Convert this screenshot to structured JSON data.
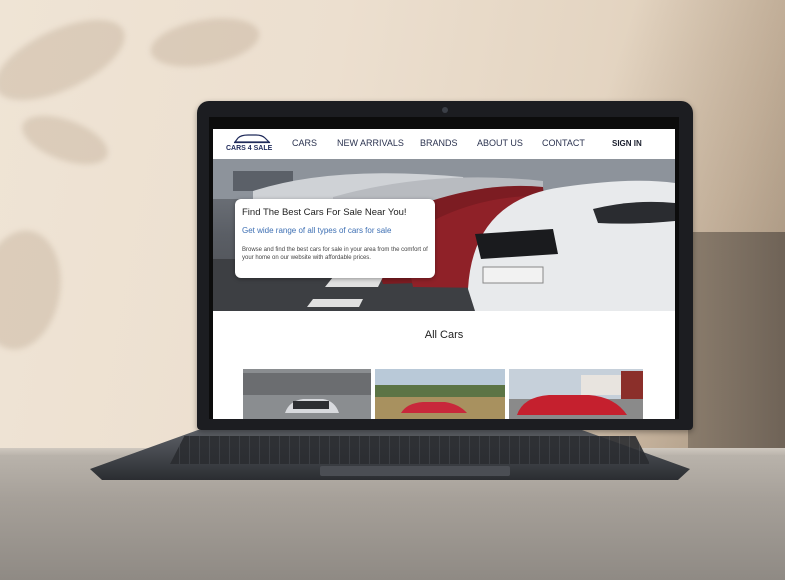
{
  "site": {
    "logo_text": "CARS 4 SALE",
    "nav": [
      "CARS",
      "NEW ARRIVALS",
      "BRANDS",
      "ABOUT US",
      "CONTACT"
    ],
    "sign_in": "SIGN IN",
    "hero": {
      "title": "Find The Best Cars For Sale Near You!",
      "subtitle": "Get wide range of all types of cars for sale",
      "description": "Browse and find the best cars for sale in your area from the comfort of your home on our website with affordable prices."
    },
    "section_title": "All Cars"
  },
  "colors": {
    "nav_text": "#2b3350",
    "subtitle": "#3d6fb3",
    "logo": "#1f2a5a",
    "laptop": "#1c1d21"
  }
}
